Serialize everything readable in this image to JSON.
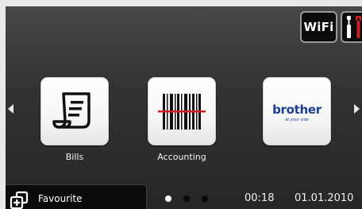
{
  "status_bar": {
    "wifi_label": "WiFi"
  },
  "apps": [
    {
      "label": "Bills",
      "icon": "bill-receipt-icon"
    },
    {
      "label": "Accounting",
      "icon": "barcode-scan-icon"
    },
    {
      "label": "",
      "icon": "brother-logo",
      "logo_text": "brother",
      "logo_tagline": "at your side"
    }
  ],
  "navigation": {
    "left_arrow_icon": "chevron-left-icon",
    "right_arrow_icon": "chevron-right-icon"
  },
  "favourite": {
    "label": "Favourite",
    "icon": "favourite-add-icon"
  },
  "pager": {
    "total_pages": 3,
    "current_page": 1
  },
  "clock": {
    "time": "00:18",
    "date": "01.01.2010"
  },
  "colors": {
    "screen_bg": "#333333",
    "tile_bg": "#f6f6f6",
    "brand_blue": "#1c3f94",
    "scan_red": "#d42020",
    "tools_red": "#cc1f1f"
  }
}
